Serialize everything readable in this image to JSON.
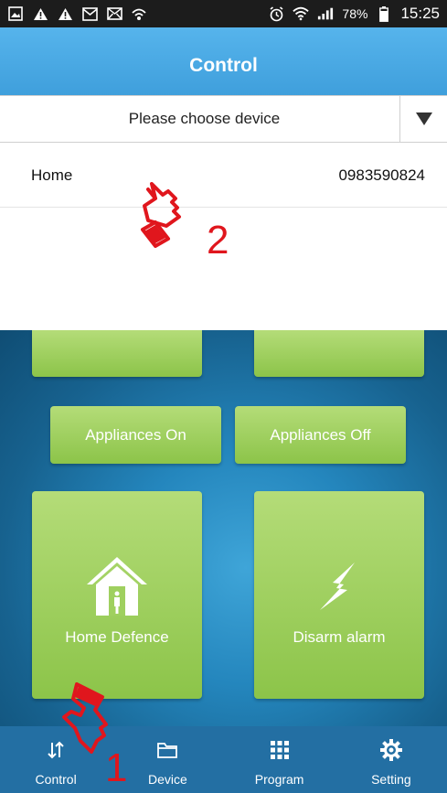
{
  "status_bar": {
    "battery": "78%",
    "time": "15:25"
  },
  "header": {
    "title": "Control"
  },
  "device_selector": {
    "placeholder": "Please choose device"
  },
  "device_list": [
    {
      "name": "Home",
      "phone": "0983590824"
    }
  ],
  "tiles": {
    "appliances_on": "Appliances On",
    "appliances_off": "Appliances Off",
    "home_defence": "Home Defence",
    "disarm_alarm": "Disarm alarm"
  },
  "bottom_nav": [
    {
      "label": "Control",
      "icon": "sort-arrows-icon"
    },
    {
      "label": "Device",
      "icon": "folder-icon"
    },
    {
      "label": "Program",
      "icon": "grid-icon"
    },
    {
      "label": "Setting",
      "icon": "gear-icon"
    }
  ],
  "annotations": {
    "step_1": "1",
    "step_2": "2"
  },
  "colors": {
    "header_blue": "#3f9fdc",
    "tile_green": "#9fd05f",
    "nav_blue": "#236fa3",
    "annotation_red": "#e0161d"
  }
}
